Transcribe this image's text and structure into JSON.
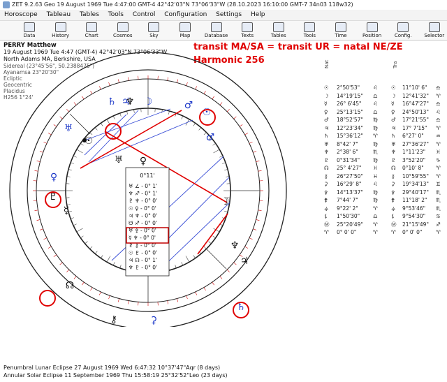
{
  "titlebar": {
    "text": "ZET 9.2.63 Geo   19 August 1969  Tue   4:47:00 GMT-4 42°42'03\"N  73°06'33\"W    (28.10.2023  16:10:00 GMT-7 34n03 118w32)"
  },
  "menu": [
    "Horoscope",
    "Tableau",
    "Tables",
    "Tools",
    "Control",
    "Configuration",
    "Settings",
    "Help"
  ],
  "toolbar": [
    "Data",
    "History",
    "Chart",
    "Cosmos",
    "Sky",
    "Map",
    "Database",
    "Texts",
    "Tables",
    "Tools",
    "Time",
    "Position",
    "Config.",
    "Selector"
  ],
  "header": {
    "name": "PERRY Matthew",
    "line1": "19 August 1969  Tue   4:47 (GMT-4) 42°42'03\"N  73°06'33\"W",
    "line2": "North Adams MA, Berkshire, USA",
    "line3": "Sidereal (23°45'56\", 50.2388475\")",
    "line4": "Ayanamsa 23°20'30\"",
    "line5": "Ecliptic",
    "line6": "Geocentric",
    "line7": "Placidus",
    "line8": "H256   1°24'"
  },
  "annotation": {
    "line1": "transit MA/SA = transit UR = natal NE/ZE",
    "line2": "Harmonic 256"
  },
  "table": {
    "col1_header": "Nat",
    "col2_header": "Tra",
    "rows": [
      {
        "g1": "☉",
        "v1": "2°50'53\"",
        "s1": "♌",
        "g2": "☉",
        "v2": "11°10' 6\"",
        "s2": "♎"
      },
      {
        "g1": "☽",
        "v1": "14°19'15\"",
        "s1": "♎",
        "g2": "☽",
        "v2": "12°41'32\"",
        "s2": "♈"
      },
      {
        "g1": "☿",
        "v1": "26° 6'45\"",
        "s1": "♌",
        "g2": "☿",
        "v2": "16°47'27\"",
        "s2": "♎"
      },
      {
        "g1": "♀",
        "v1": "25°13'15\"",
        "s1": "♎",
        "g2": "♀",
        "v2": "24°50'13\"",
        "s2": "♌"
      },
      {
        "g1": "♂",
        "v1": "18°52'57\"",
        "s1": "♍",
        "g2": "♂",
        "v2": "17°21'55\"",
        "s2": "♎"
      },
      {
        "g1": "♃",
        "v1": "12°23'34\"",
        "s1": "♍",
        "g2": "♃",
        "v2": "17° 7'15\"",
        "s2": "♈"
      },
      {
        "g1": "♄",
        "v1": "15°36'12\"",
        "s1": "♈",
        "g2": "♄",
        "v2": "6°27' 0\"",
        "s2": "♒"
      },
      {
        "g1": "♅",
        "v1": "8°42' 7\"",
        "s1": "♍",
        "g2": "♅",
        "v2": "27°36'27\"",
        "s2": "♈"
      },
      {
        "g1": "♆",
        "v1": "2°38' 6\"",
        "s1": "♏",
        "g2": "♆",
        "v2": "1°11'23\"",
        "s2": "♓"
      },
      {
        "g1": "♇",
        "v1": "0°31'34\"",
        "s1": "♍",
        "g2": "♇",
        "v2": "3°52'20\"",
        "s2": "♑"
      },
      {
        "g1": "☊",
        "v1": "25° 4'27\"",
        "s1": "♓",
        "g2": "☊",
        "v2": "0°10' 8\"",
        "s2": "♈"
      },
      {
        "g1": "⚷",
        "v1": "26°27'50\"",
        "s1": "♓",
        "g2": "⚷",
        "v2": "10°59'55\"",
        "s2": "♈"
      },
      {
        "g1": "⚳",
        "v1": "16°29' 8\"",
        "s1": "♌",
        "g2": "⚳",
        "v2": "19°34'13\"",
        "s2": "♊"
      },
      {
        "g1": "⚴",
        "v1": "14°13'37\"",
        "s1": "♍",
        "g2": "⚴",
        "v2": "29°40'17\"",
        "s2": "♏"
      },
      {
        "g1": "⚵",
        "v1": "7°44' 7\"",
        "s1": "♍",
        "g2": "⚵",
        "v2": "11°18' 2\"",
        "s2": "♏"
      },
      {
        "g1": "⚶",
        "v1": "9°22' 2\"",
        "s1": "♈",
        "g2": "⚶",
        "v2": "9°53'46\"",
        "s2": "♏"
      },
      {
        "g1": "⚸",
        "v1": "1°50'30\"",
        "s1": "♎",
        "g2": "⚸",
        "v2": "9°54'30\"",
        "s2": "♋"
      },
      {
        "g1": "Ⓜ",
        "v1": "25°20'49\"",
        "s1": "♈",
        "g2": "Ⓜ",
        "v2": "21°15'49\"",
        "s2": "♐"
      },
      {
        "g1": "♈",
        "v1": "0° 0' 0\"",
        "s1": "♈",
        "g2": "♈",
        "v2": "0° 0' 0\"",
        "s2": "♈"
      }
    ]
  },
  "chart_box": {
    "title": "0°11'",
    "rows": [
      "♅  ∠  - 0° 1'",
      "♆  ♐  - 0° 1'",
      "♇  ♆  - 0° 0'",
      "☉  ♀  - 0° 0'",
      "♃  ♆  - 0° 0'",
      "☋  ♐  - 0° 0'",
      "♅  ⚴  - 0° 0'",
      "☿  ♆  - 0° 0'",
      "♇  ⚷  - 0° 0'",
      "☉  ♇  - 0° 0'",
      "♃  ☊  - 0° 1'",
      "♆  ♇  - 0° 0'"
    ]
  },
  "chart_glyphs": [
    "♄",
    "♃",
    "♆",
    "☽",
    "♂",
    "☉",
    "♅",
    "♀",
    "☿",
    "♇",
    "☊",
    "⚷",
    "⚳"
  ],
  "bottom": {
    "line1": "Penumbral Lunar Eclipse 27 August 1969 Wed  6:47:32 10°37'47\"Aqr (8 days)",
    "line2": "Annular Solar Eclipse 11 September 1969 Thu 15:58:19 25°32'52\"Leo (23 days)"
  },
  "colors": {
    "accent": "#e00000",
    "blue": "#1a36c8",
    "line_blue": "#3a4fd6"
  }
}
